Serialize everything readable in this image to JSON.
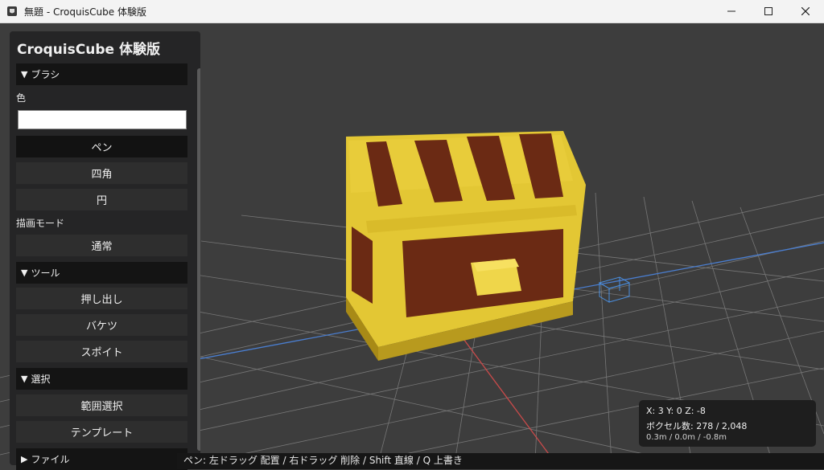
{
  "window": {
    "title": "無題 - CroquisCube 体験版"
  },
  "panel": {
    "title": "CroquisCube 体験版",
    "brush_section": "ブラシ",
    "color_label": "色",
    "color_value": "#ffffff",
    "pen_label": "ペン",
    "rect_label": "四角",
    "circle_label": "円",
    "draw_mode_label": "描画モード",
    "draw_mode_value": "通常",
    "tools_section": "ツール",
    "extrude_label": "押し出し",
    "bucket_label": "バケツ",
    "eyedropper_label": "スポイト",
    "select_section": "選択",
    "range_select_label": "範囲選択",
    "template_label": "テンプレート",
    "file_section": "ファイル",
    "expanded_marker": "▼",
    "collapsed_marker": "▶"
  },
  "status": {
    "coords": "X: 3   Y: 0   Z: -8",
    "voxel_count": "ボクセル数: 278 / 2,048",
    "meters": "0.3m / 0.0m / -0.8m"
  },
  "hint_bar": "ペン: 左ドラッグ 配置 / 右ドラッグ 削除 / Shift 直線 / Q 上書き",
  "colors": {
    "chest_gold": "#e3c734",
    "chest_wood": "#6b2a14",
    "grid_line": "#8a8a8a",
    "x_axis": "#c84a4a",
    "z_axis": "#4a7ed0",
    "cursor_cube": "#4a8fe0"
  }
}
